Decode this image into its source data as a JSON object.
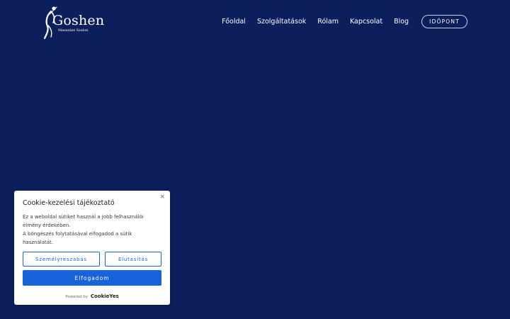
{
  "colors": {
    "background": "#0b1f5c",
    "accent": "#1863dc",
    "banner_bg": "#ffffff"
  },
  "header": {
    "logo": {
      "name": "Goshen",
      "tagline": "Masszázs Szalon"
    },
    "nav": [
      {
        "label": "Főoldal"
      },
      {
        "label": "Szolgáltatások"
      },
      {
        "label": "Rólam"
      },
      {
        "label": "Kapcsolat"
      },
      {
        "label": "Blog"
      }
    ],
    "cta_label": "IDŐPONT"
  },
  "cookie_banner": {
    "close_icon": "close-icon",
    "close_glyph": "×",
    "title": "Cookie-kezelési tájékoztató",
    "body_line1": "Ez a weboldal sütiket használ a jobb felhasználói élmény érdekében.",
    "body_line2": "A böngészés folytatásával elfogadod a sütik használatát.",
    "customize_label": "Személyreszabás",
    "reject_label": "Elutasítás",
    "accept_label": "Elfogadom",
    "powered_by": "Powered by",
    "powered_brand": "CookieYes"
  }
}
